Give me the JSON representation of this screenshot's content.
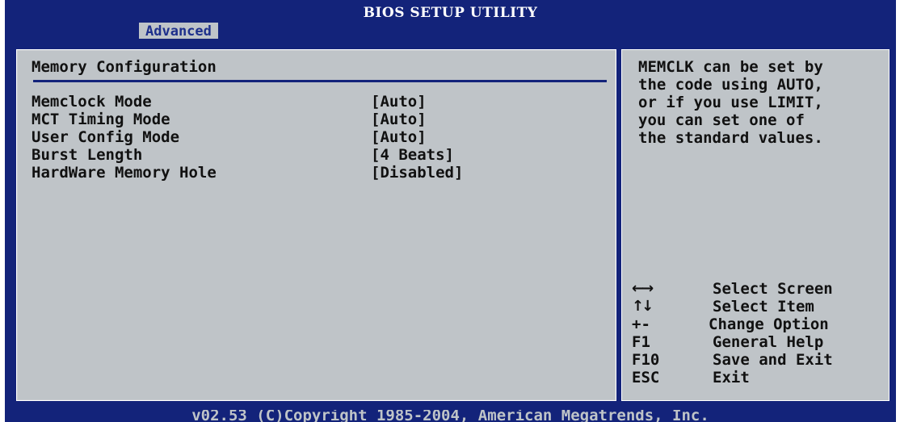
{
  "header": {
    "title": "BIOS SETUP UTILITY",
    "active_tab": "Advanced"
  },
  "main": {
    "section_title": "Memory Configuration",
    "settings": [
      {
        "label": "Memclock Mode",
        "value": "[Auto]"
      },
      {
        "label": "MCT Timing Mode",
        "value": "[Auto]"
      },
      {
        "label": "User Config Mode",
        "value": "[Auto]"
      },
      {
        "label": "Burst Length",
        "value": "[4 Beats]"
      },
      {
        "label": "HardWare Memory Hole",
        "value": "[Disabled]"
      }
    ]
  },
  "help": {
    "lines": [
      "MEMCLK can be set by",
      "the code using AUTO,",
      "or if you use LIMIT,",
      "you can set one of",
      "the standard values."
    ]
  },
  "keys": [
    {
      "key": "←→",
      "icon": "left-right-arrows-icon",
      "desc": "Select Screen"
    },
    {
      "key": "↑↓",
      "icon": "up-down-arrows-icon",
      "desc": "Select Item"
    },
    {
      "key": "+-",
      "icon": "plus-minus-icon",
      "desc": "Change Option"
    },
    {
      "key": "F1",
      "desc": "General Help"
    },
    {
      "key": "F10",
      "desc": "Save and Exit"
    },
    {
      "key": "ESC",
      "desc": "Exit"
    }
  ],
  "footer": {
    "copyright": "v02.53 (C)Copyright 1985-2004, American Megatrends, Inc."
  },
  "colors": {
    "frame_blue": "#13237a",
    "panel_gray": "#bfc4c8",
    "tab_text": "#1d2f8c"
  }
}
